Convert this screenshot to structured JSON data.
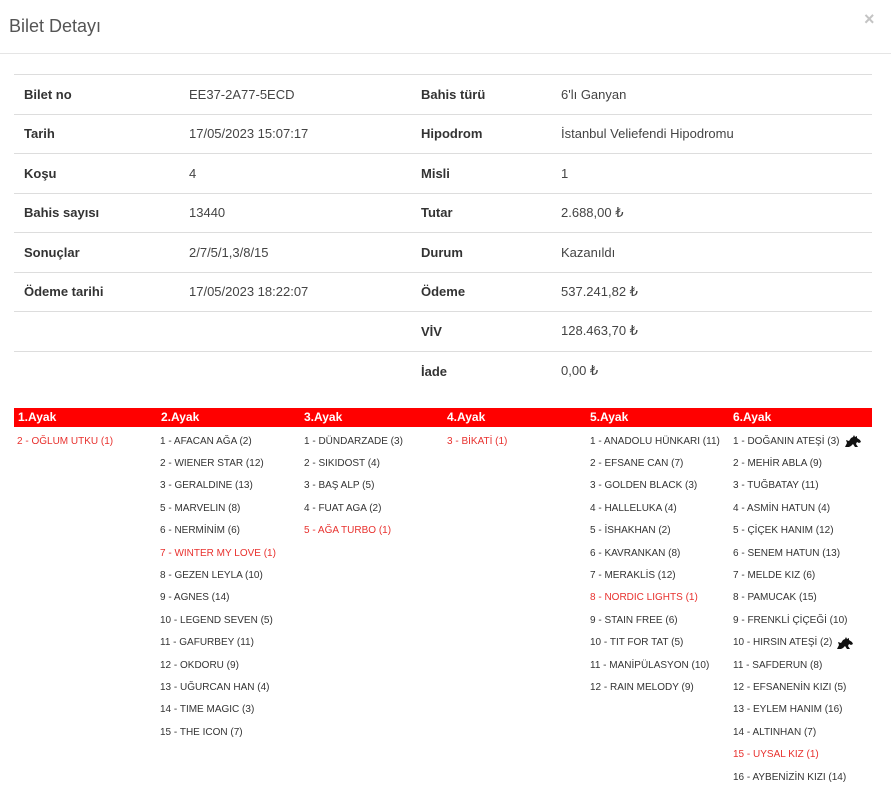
{
  "modal": {
    "title": "Bilet Detayı",
    "close_label": "×"
  },
  "info": {
    "rows": [
      {
        "l1": "Bilet no",
        "v1": "EE37-2A77-5ECD",
        "l2": "Bahis türü",
        "v2": "6'lı Ganyan"
      },
      {
        "l1": "Tarih",
        "v1": "17/05/2023 15:07:17",
        "l2": "Hipodrom",
        "v2": "İstanbul Veliefendi Hipodromu"
      },
      {
        "l1": "Koşu",
        "v1": "4",
        "l2": "Misli",
        "v2": "1"
      },
      {
        "l1": "Bahis sayısı",
        "v1": "13440",
        "l2": "Tutar",
        "v2": "2.688,00 ₺"
      },
      {
        "l1": "Sonuçlar",
        "v1": "2/7/5/1,3/8/15",
        "l2": "Durum",
        "v2": "Kazanıldı"
      },
      {
        "l1": "Ödeme tarihi",
        "v1": "17/05/2023 18:22:07",
        "l2": "Ödeme",
        "v2": "537.241,82 ₺"
      },
      {
        "l1": "",
        "v1": "",
        "l2": "VİV",
        "v2": "128.463,70 ₺"
      },
      {
        "l1": "",
        "v1": "",
        "l2": "İade",
        "v2": "0,00 ₺"
      }
    ]
  },
  "legs": [
    {
      "title": "1.Ayak",
      "runners": [
        {
          "text": "2 - OĞLUM UTKU (1)",
          "winner": true
        }
      ]
    },
    {
      "title": "2.Ayak",
      "runners": [
        {
          "text": "1 - AFACAN AĞA (2)"
        },
        {
          "text": "2 - WIENER STAR (12)"
        },
        {
          "text": "3 - GERALDINE (13)"
        },
        {
          "text": "5 - MARVELIN (8)"
        },
        {
          "text": "6 - NERMİNİM (6)"
        },
        {
          "text": "7 - WINTER MY LOVE (1)",
          "winner": true
        },
        {
          "text": "8 - GEZEN LEYLA (10)"
        },
        {
          "text": "9 - AGNES (14)"
        },
        {
          "text": "10 - LEGEND SEVEN (5)"
        },
        {
          "text": "11 - GAFURBEY (11)"
        },
        {
          "text": "12 - OKDORU (9)"
        },
        {
          "text": "13 - UĞURCAN HAN (4)"
        },
        {
          "text": "14 - TIME MAGIC (3)"
        },
        {
          "text": "15 - THE ICON (7)"
        }
      ]
    },
    {
      "title": "3.Ayak",
      "runners": [
        {
          "text": "1 - DÜNDARZADE (3)"
        },
        {
          "text": "2 - SIKIDOST (4)"
        },
        {
          "text": "3 - BAŞ ALP (5)"
        },
        {
          "text": "4 - FUAT AGA (2)"
        },
        {
          "text": "5 - AĞA TURBO (1)",
          "winner": true
        }
      ]
    },
    {
      "title": "4.Ayak",
      "runners": [
        {
          "text": "3 - BİKATİ (1)",
          "winner": true
        }
      ]
    },
    {
      "title": "5.Ayak",
      "runners": [
        {
          "text": "1 - ANADOLU HÜNKARI (11)"
        },
        {
          "text": "2 - EFSANE CAN (7)"
        },
        {
          "text": "3 - GOLDEN BLACK (3)"
        },
        {
          "text": "4 - HALLELUKA (4)"
        },
        {
          "text": "5 - İSHAKHAN (2)"
        },
        {
          "text": "6 - KAVRANKAN (8)"
        },
        {
          "text": "7 - MERAKLİS (12)"
        },
        {
          "text": "8 - NORDIC LIGHTS (1)",
          "winner": true
        },
        {
          "text": "9 - STAIN FREE (6)"
        },
        {
          "text": "10 - TIT FOR TAT (5)"
        },
        {
          "text": "11 - MANİPÜLASYON (10)"
        },
        {
          "text": "12 - RAIN MELODY (9)"
        }
      ]
    },
    {
      "title": "6.Ayak",
      "runners": [
        {
          "text": "1 - DOĞANIN ATEŞİ (3)",
          "icon": "horse-icon"
        },
        {
          "text": "2 - MEHİR ABLA (9)"
        },
        {
          "text": "3 - TUĞBATAY (11)"
        },
        {
          "text": "4 - ASMİN HATUN (4)"
        },
        {
          "text": "5 - ÇİÇEK HANIM (12)"
        },
        {
          "text": "6 - SENEM HATUN (13)"
        },
        {
          "text": "7 - MELDE KIZ (6)"
        },
        {
          "text": "8 - PAMUCAK (15)"
        },
        {
          "text": "9 - FRENKLİ ÇİÇEĞİ (10)"
        },
        {
          "text": "10 - HIRSIN ATEŞİ (2)",
          "icon": "horse-icon"
        },
        {
          "text": "11 - SAFDERUN (8)"
        },
        {
          "text": "12 - EFSANENİN KIZI (5)"
        },
        {
          "text": "13 - EYLEM HANIM (16)"
        },
        {
          "text": "14 - ALTINHAN (7)"
        },
        {
          "text": "15 - UYSAL KIZ (1)",
          "winner": true
        },
        {
          "text": "16 - AYBENİZİN KIZI (14)"
        }
      ]
    }
  ],
  "colors": {
    "accent": "#ff0000",
    "winner_text": "#e8312e"
  }
}
